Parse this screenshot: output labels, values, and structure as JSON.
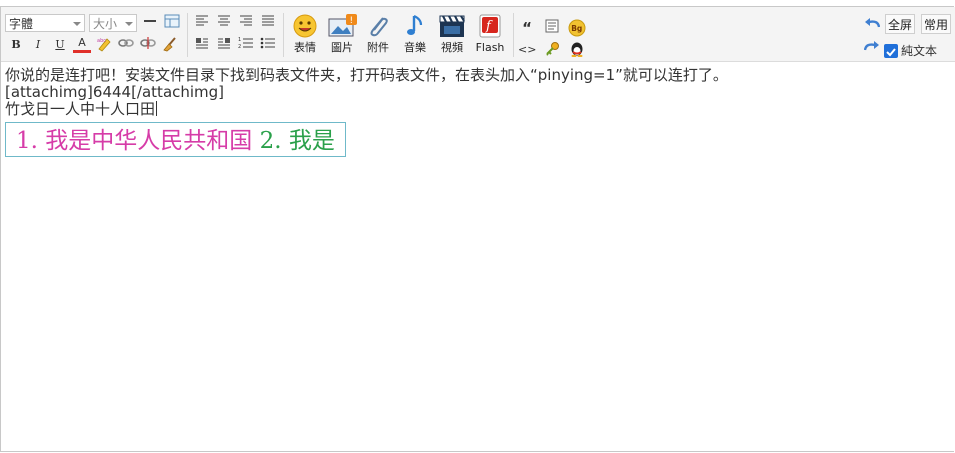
{
  "toolbar": {
    "font_select": "字體",
    "size_select": "大小",
    "bold": "B",
    "italic": "I",
    "underline": "U",
    "text_color": "A",
    "media": {
      "emoticon": "表情",
      "image": "圖片",
      "attachment": "附件",
      "audio": "音樂",
      "video": "視頻",
      "flash": "Flash"
    },
    "quote_glyph": "“",
    "code_glyph": "<>",
    "bg_glyph": "Bg",
    "fullscreen": "全屏",
    "common": "常用",
    "plain_text": "純文本",
    "plain_text_checked": true
  },
  "editor": {
    "line1": "你说的是连打吧！安装文件目录下找到码表文件夹，打开码表文件，在表头加入“pinying=1”就可以连打了。",
    "line2": "[attachimg]6444[/attachimg]",
    "line3": "竹戈日一人中十人口田",
    "boxed_part1": "1. 我是中华人民共和国 ",
    "boxed_part2": "2. 我是"
  },
  "colors": {
    "pink": "#d63ca8",
    "green": "#2aa04a",
    "box_border": "#6fb9c9"
  }
}
